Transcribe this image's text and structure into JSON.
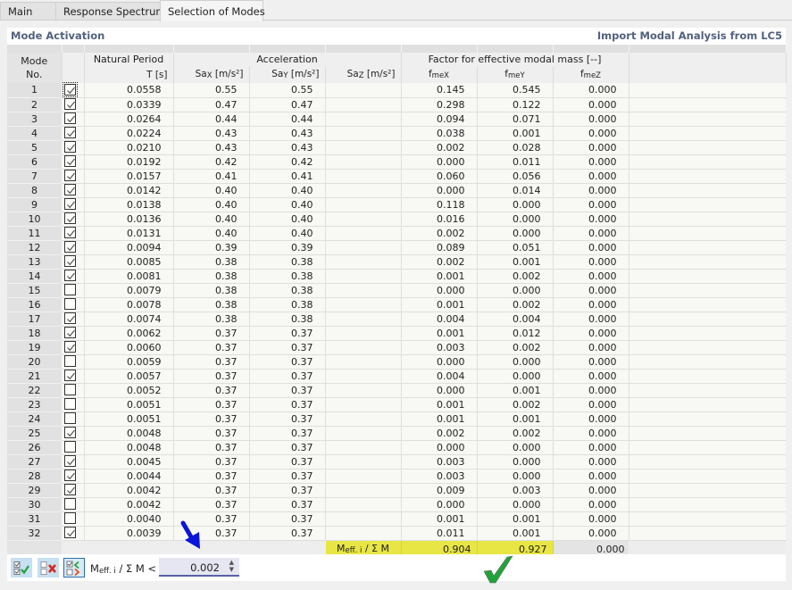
{
  "tabs": [
    {
      "label": "Main",
      "active": false
    },
    {
      "label": "Response Spectrum",
      "active": false
    },
    {
      "label": "Selection of Modes",
      "active": true
    }
  ],
  "section": {
    "title": "Mode Activation",
    "import_link": "Import Modal Analysis from LC5"
  },
  "headers": {
    "mode_line1": "Mode",
    "mode_line2": "No.",
    "natural_period": "Natural Period",
    "period_unit": "T [s]",
    "acceleration": "Acceleration",
    "sax": "Sa",
    "sax_sub": "X",
    "say": "Sa",
    "say_sub": "Y",
    "saz": "Sa",
    "saz_sub": "Z",
    "acc_unit": " [m/s²]",
    "factor": "Factor for effective modal mass [--]",
    "fmex": "f",
    "fmex_sub": "meX",
    "fmey": "f",
    "fmey_sub": "meY",
    "fmez": "f",
    "fmez_sub": "meZ"
  },
  "rows": [
    {
      "no": "1",
      "checked": true,
      "T": "0.0558",
      "SaX": "0.55",
      "SaY": "0.55",
      "SaZ": "",
      "fmeX": "0.145",
      "fmeY": "0.545",
      "fmeZ": "0.000"
    },
    {
      "no": "2",
      "checked": true,
      "T": "0.0339",
      "SaX": "0.47",
      "SaY": "0.47",
      "SaZ": "",
      "fmeX": "0.298",
      "fmeY": "0.122",
      "fmeZ": "0.000"
    },
    {
      "no": "3",
      "checked": true,
      "T": "0.0264",
      "SaX": "0.44",
      "SaY": "0.44",
      "SaZ": "",
      "fmeX": "0.094",
      "fmeY": "0.071",
      "fmeZ": "0.000"
    },
    {
      "no": "4",
      "checked": true,
      "T": "0.0224",
      "SaX": "0.43",
      "SaY": "0.43",
      "SaZ": "",
      "fmeX": "0.038",
      "fmeY": "0.001",
      "fmeZ": "0.000"
    },
    {
      "no": "5",
      "checked": true,
      "T": "0.0210",
      "SaX": "0.43",
      "SaY": "0.43",
      "SaZ": "",
      "fmeX": "0.002",
      "fmeY": "0.028",
      "fmeZ": "0.000"
    },
    {
      "no": "6",
      "checked": true,
      "T": "0.0192",
      "SaX": "0.42",
      "SaY": "0.42",
      "SaZ": "",
      "fmeX": "0.000",
      "fmeY": "0.011",
      "fmeZ": "0.000"
    },
    {
      "no": "7",
      "checked": true,
      "T": "0.0157",
      "SaX": "0.41",
      "SaY": "0.41",
      "SaZ": "",
      "fmeX": "0.060",
      "fmeY": "0.056",
      "fmeZ": "0.000"
    },
    {
      "no": "8",
      "checked": true,
      "T": "0.0142",
      "SaX": "0.40",
      "SaY": "0.40",
      "SaZ": "",
      "fmeX": "0.000",
      "fmeY": "0.014",
      "fmeZ": "0.000"
    },
    {
      "no": "9",
      "checked": true,
      "T": "0.0138",
      "SaX": "0.40",
      "SaY": "0.40",
      "SaZ": "",
      "fmeX": "0.118",
      "fmeY": "0.000",
      "fmeZ": "0.000"
    },
    {
      "no": "10",
      "checked": true,
      "T": "0.0136",
      "SaX": "0.40",
      "SaY": "0.40",
      "SaZ": "",
      "fmeX": "0.016",
      "fmeY": "0.000",
      "fmeZ": "0.000"
    },
    {
      "no": "11",
      "checked": true,
      "T": "0.0131",
      "SaX": "0.40",
      "SaY": "0.40",
      "SaZ": "",
      "fmeX": "0.002",
      "fmeY": "0.000",
      "fmeZ": "0.000"
    },
    {
      "no": "12",
      "checked": true,
      "T": "0.0094",
      "SaX": "0.39",
      "SaY": "0.39",
      "SaZ": "",
      "fmeX": "0.089",
      "fmeY": "0.051",
      "fmeZ": "0.000"
    },
    {
      "no": "13",
      "checked": true,
      "T": "0.0085",
      "SaX": "0.38",
      "SaY": "0.38",
      "SaZ": "",
      "fmeX": "0.002",
      "fmeY": "0.001",
      "fmeZ": "0.000"
    },
    {
      "no": "14",
      "checked": true,
      "T": "0.0081",
      "SaX": "0.38",
      "SaY": "0.38",
      "SaZ": "",
      "fmeX": "0.001",
      "fmeY": "0.002",
      "fmeZ": "0.000"
    },
    {
      "no": "15",
      "checked": false,
      "T": "0.0079",
      "SaX": "0.38",
      "SaY": "0.38",
      "SaZ": "",
      "fmeX": "0.000",
      "fmeY": "0.000",
      "fmeZ": "0.000"
    },
    {
      "no": "16",
      "checked": false,
      "T": "0.0078",
      "SaX": "0.38",
      "SaY": "0.38",
      "SaZ": "",
      "fmeX": "0.001",
      "fmeY": "0.002",
      "fmeZ": "0.000"
    },
    {
      "no": "17",
      "checked": true,
      "T": "0.0074",
      "SaX": "0.38",
      "SaY": "0.38",
      "SaZ": "",
      "fmeX": "0.004",
      "fmeY": "0.004",
      "fmeZ": "0.000"
    },
    {
      "no": "18",
      "checked": true,
      "T": "0.0062",
      "SaX": "0.37",
      "SaY": "0.37",
      "SaZ": "",
      "fmeX": "0.001",
      "fmeY": "0.012",
      "fmeZ": "0.000"
    },
    {
      "no": "19",
      "checked": true,
      "T": "0.0060",
      "SaX": "0.37",
      "SaY": "0.37",
      "SaZ": "",
      "fmeX": "0.003",
      "fmeY": "0.002",
      "fmeZ": "0.000"
    },
    {
      "no": "20",
      "checked": false,
      "T": "0.0059",
      "SaX": "0.37",
      "SaY": "0.37",
      "SaZ": "",
      "fmeX": "0.000",
      "fmeY": "0.000",
      "fmeZ": "0.000"
    },
    {
      "no": "21",
      "checked": true,
      "T": "0.0057",
      "SaX": "0.37",
      "SaY": "0.37",
      "SaZ": "",
      "fmeX": "0.004",
      "fmeY": "0.000",
      "fmeZ": "0.000"
    },
    {
      "no": "22",
      "checked": false,
      "T": "0.0052",
      "SaX": "0.37",
      "SaY": "0.37",
      "SaZ": "",
      "fmeX": "0.000",
      "fmeY": "0.001",
      "fmeZ": "0.000"
    },
    {
      "no": "23",
      "checked": false,
      "T": "0.0051",
      "SaX": "0.37",
      "SaY": "0.37",
      "SaZ": "",
      "fmeX": "0.001",
      "fmeY": "0.002",
      "fmeZ": "0.000"
    },
    {
      "no": "24",
      "checked": false,
      "T": "0.0051",
      "SaX": "0.37",
      "SaY": "0.37",
      "SaZ": "",
      "fmeX": "0.001",
      "fmeY": "0.001",
      "fmeZ": "0.000"
    },
    {
      "no": "25",
      "checked": true,
      "T": "0.0048",
      "SaX": "0.37",
      "SaY": "0.37",
      "SaZ": "",
      "fmeX": "0.002",
      "fmeY": "0.002",
      "fmeZ": "0.000"
    },
    {
      "no": "26",
      "checked": false,
      "T": "0.0048",
      "SaX": "0.37",
      "SaY": "0.37",
      "SaZ": "",
      "fmeX": "0.000",
      "fmeY": "0.000",
      "fmeZ": "0.000"
    },
    {
      "no": "27",
      "checked": true,
      "T": "0.0045",
      "SaX": "0.37",
      "SaY": "0.37",
      "SaZ": "",
      "fmeX": "0.003",
      "fmeY": "0.000",
      "fmeZ": "0.000"
    },
    {
      "no": "28",
      "checked": true,
      "T": "0.0044",
      "SaX": "0.37",
      "SaY": "0.37",
      "SaZ": "",
      "fmeX": "0.003",
      "fmeY": "0.000",
      "fmeZ": "0.000"
    },
    {
      "no": "29",
      "checked": true,
      "T": "0.0042",
      "SaX": "0.37",
      "SaY": "0.37",
      "SaZ": "",
      "fmeX": "0.009",
      "fmeY": "0.003",
      "fmeZ": "0.000"
    },
    {
      "no": "30",
      "checked": false,
      "T": "0.0042",
      "SaX": "0.37",
      "SaY": "0.37",
      "SaZ": "",
      "fmeX": "0.000",
      "fmeY": "0.000",
      "fmeZ": "0.000"
    },
    {
      "no": "31",
      "checked": false,
      "T": "0.0040",
      "SaX": "0.37",
      "SaY": "0.37",
      "SaZ": "",
      "fmeX": "0.001",
      "fmeY": "0.001",
      "fmeZ": "0.000"
    },
    {
      "no": "32",
      "checked": true,
      "T": "0.0039",
      "SaX": "0.37",
      "SaY": "0.37",
      "SaZ": "",
      "fmeX": "0.011",
      "fmeY": "0.001",
      "fmeZ": "0.000"
    }
  ],
  "summary": {
    "label_main": "M",
    "label_sub": "eff. i",
    "label_rest": " / Σ M",
    "fmeX": "0.904",
    "fmeY": "0.927",
    "fmeZ": "0.000",
    "highlight_color": "#e8e645"
  },
  "toolbar": {
    "select_all_icon": "check-all-icon",
    "deselect_all_icon": "uncheck-all-icon",
    "filter_toggle_icon": "filter-select-icon",
    "filter_label_main": "M",
    "filter_label_sub": "eff. i",
    "filter_label_rest": " / Σ M <",
    "threshold_value": "0.002"
  },
  "annotations": {
    "arrow_color": "#0a14d8",
    "check_color": "#1fa33a"
  }
}
